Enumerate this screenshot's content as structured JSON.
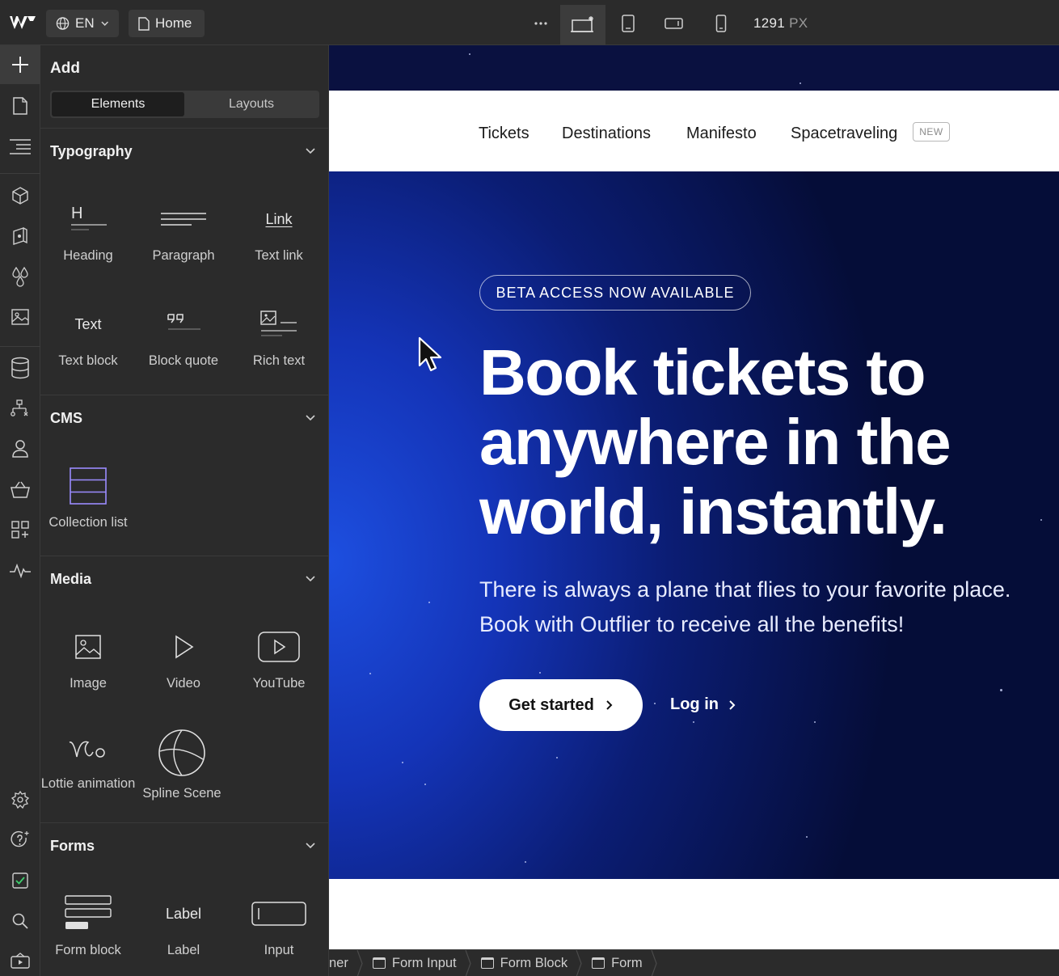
{
  "topbar": {
    "language": "EN",
    "page": "Home",
    "more_icon": "ellipsis-icon",
    "width_value": "1291",
    "width_unit": "PX"
  },
  "panel": {
    "title": "Add",
    "tabs": [
      "Elements",
      "Layouts"
    ],
    "sections": {
      "typography": {
        "title": "Typography",
        "items": [
          "Heading",
          "Paragraph",
          "Text link",
          "Text block",
          "Block quote",
          "Rich text"
        ],
        "glyphs": {
          "heading": "H",
          "link": "Link",
          "text": "Text"
        }
      },
      "cms": {
        "title": "CMS",
        "items": [
          "Collection list"
        ]
      },
      "media": {
        "title": "Media",
        "items": [
          "Image",
          "Video",
          "YouTube",
          "Lottie animation",
          "Spline Scene"
        ]
      },
      "forms": {
        "title": "Forms",
        "items": [
          "Form block",
          "Label",
          "Input"
        ],
        "glyphs": {
          "label": "Label"
        }
      }
    }
  },
  "canvas": {
    "nav": [
      "Tickets",
      "Destinations",
      "Manifesto",
      "Spacetraveling"
    ],
    "new_badge": "NEW",
    "beta": "BETA ACCESS NOW AVAILABLE",
    "headline": "Book tickets to anywhere in the world, instantly.",
    "subcopy": "There is always a plane that flies to your favorite place. Book with Outflier to receive all the benefits!",
    "cta_primary": "Get started",
    "cta_secondary": "Log in"
  },
  "breadcrumbs": [
    "ner",
    "Form Input",
    "Form Block",
    "Form"
  ],
  "colors": {
    "ui_bg": "#2b2b2b",
    "hero_blue": "#1434b8",
    "hero_dark": "#050d38",
    "accent_purple": "#9b8cff"
  }
}
